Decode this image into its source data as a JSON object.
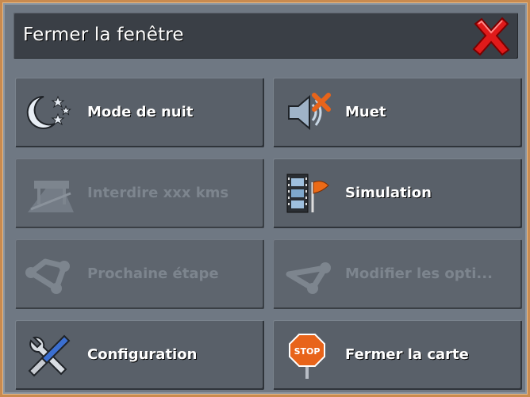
{
  "window": {
    "title": "Fermer la fenêtre",
    "close_icon": "close-x-icon",
    "accent_color": "#c98a4e",
    "close_color": "#e01a1a"
  },
  "menu": {
    "items": [
      {
        "label": "Mode de nuit",
        "icon": "moon-stars-icon",
        "enabled": true
      },
      {
        "label": "Muet",
        "icon": "speaker-mute-icon",
        "enabled": true
      },
      {
        "label": "Interdire xxx kms",
        "icon": "road-block-icon",
        "enabled": false
      },
      {
        "label": "Simulation",
        "icon": "film-flag-icon",
        "enabled": true
      },
      {
        "label": "Prochaine étape",
        "icon": "route-waypoints-icon",
        "enabled": false
      },
      {
        "label": "Modifier les opti...",
        "icon": "route-options-icon",
        "enabled": false
      },
      {
        "label": "Configuration",
        "icon": "wrench-screwdriver-icon",
        "enabled": true
      },
      {
        "label": "Fermer la carte",
        "icon": "stop-sign-icon",
        "enabled": true
      }
    ]
  }
}
